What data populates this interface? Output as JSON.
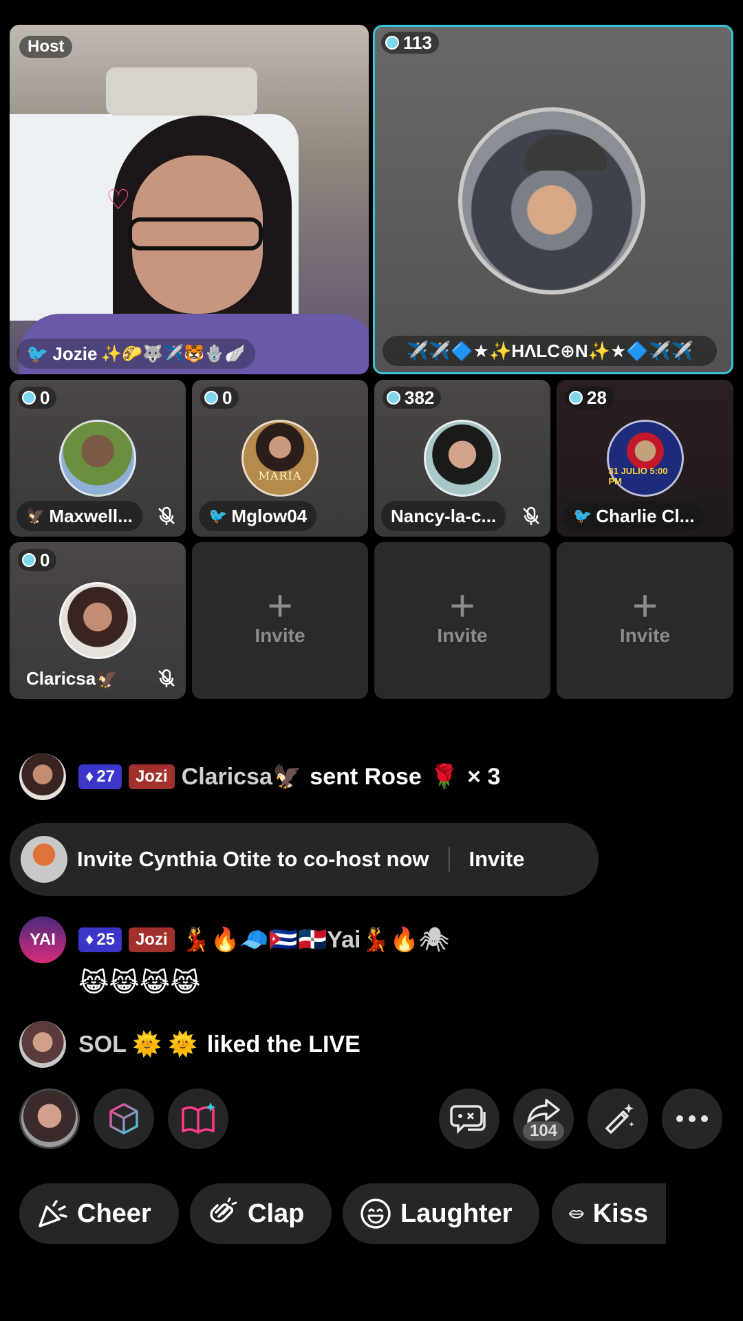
{
  "host_tile": {
    "badge": "Host",
    "name": "Jozie",
    "name_emojis": "✨🌮🐺✈️🐯🪬🪽"
  },
  "featured_tile": {
    "coins": "113",
    "name": "✈️✈️🔷★✨HΛLC⊕N✨★🔷✈️✈️"
  },
  "guests": [
    {
      "coins": "0",
      "name": "Maxwell...",
      "muted": true,
      "prefix": "🦅"
    },
    {
      "coins": "0",
      "name": "Mglow04",
      "muted": false,
      "prefix": "🐦"
    },
    {
      "coins": "382",
      "name": "Nancy-la-c...",
      "muted": true,
      "prefix": ""
    },
    {
      "coins": "28",
      "name": "Charlie Cl...",
      "muted": false,
      "prefix": "🐦"
    },
    {
      "coins": "0",
      "name": "Claricsa🦅",
      "muted": true,
      "prefix": ""
    }
  ],
  "invite_slot_label": "Invite",
  "guest_avatar_texts": {
    "maria": "MARIA",
    "charlie_date": "31 JULIO 5:00 PM"
  },
  "chat": {
    "gift": {
      "level": "27",
      "fan_badge": "Jozi",
      "user": "Claricsa🦅",
      "text": "sent Rose",
      "gift_emoji": "🌹",
      "count": "× 3"
    },
    "invite_banner": {
      "text": "Invite Cynthia Otite to co-host now",
      "action": "Invite"
    },
    "message": {
      "avatar_text": "YAI",
      "level": "25",
      "fan_badge": "Jozi",
      "user": "💃🔥🧢🇨🇺🇩🇴Yai💃🔥🕷",
      "body": "😹😹😹😹"
    },
    "like": {
      "user": "SOL 🌞 🌞",
      "text": "liked the LIVE"
    }
  },
  "toolbar": {
    "share_count": "104"
  },
  "reactions": [
    {
      "label": "Cheer",
      "icon": "cheer-icon"
    },
    {
      "label": "Clap",
      "icon": "clap-icon"
    },
    {
      "label": "Laughter",
      "icon": "laughter-icon"
    },
    {
      "label": "Kiss",
      "icon": "kiss-icon"
    }
  ],
  "colors": {
    "selected_border": "#39c4d6",
    "diamond_badge": "#3b35c9",
    "fan_badge": "#a3302c",
    "accent_pink": "#ff3b8a"
  }
}
